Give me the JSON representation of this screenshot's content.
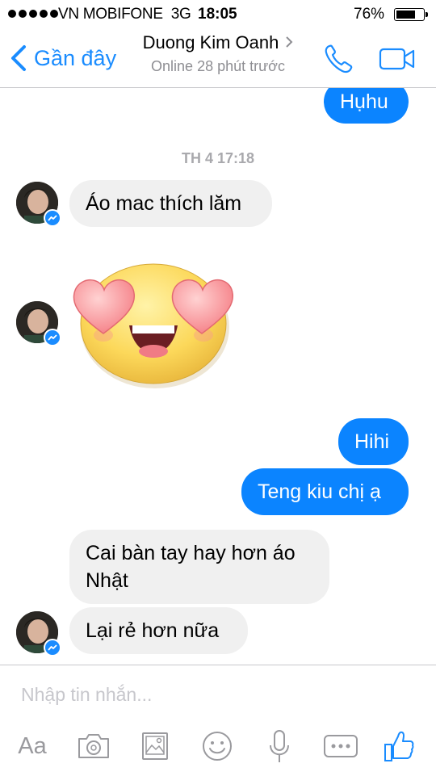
{
  "status_bar": {
    "carrier": "VN MOBIFONE",
    "network": "3G",
    "time": "18:05",
    "battery_percent": "76%",
    "battery_level": 0.76
  },
  "nav": {
    "back_label": "Gần đây",
    "title": "Duong Kim Oanh",
    "subtitle": "Online 28 phút trước",
    "icons": [
      "back-chevron-icon",
      "phone-icon",
      "video-camera-icon"
    ]
  },
  "conversation": {
    "messages": [
      {
        "sender": "me",
        "text": "Hụhu"
      },
      {
        "type": "timestamp",
        "text": "TH 4 17:18"
      },
      {
        "sender": "contact",
        "text": "Áo mac thích lăm"
      },
      {
        "sender": "contact",
        "type": "sticker",
        "sticker": "heart-eyes-emoji"
      },
      {
        "sender": "me",
        "text": "Hihi"
      },
      {
        "sender": "me",
        "text": "Teng kiu chị ạ"
      },
      {
        "sender": "contact",
        "text": "Cai bàn tay hay hơn áo Nhật"
      },
      {
        "sender": "contact",
        "text": "Lại rẻ hơn nữa"
      }
    ]
  },
  "composer": {
    "placeholder": "Nhập tin nhắn...",
    "value": "",
    "text_button": "Aa",
    "icons": [
      "camera-icon",
      "photo-gallery-icon",
      "emoji-icon",
      "microphone-icon",
      "more-icon",
      "thumbs-up-icon"
    ]
  },
  "colors": {
    "accent": "#1a8cff",
    "outgoing_bubble": "#0b84ff",
    "incoming_bubble": "#f0f0f0",
    "muted_text": "#8e8e93"
  }
}
